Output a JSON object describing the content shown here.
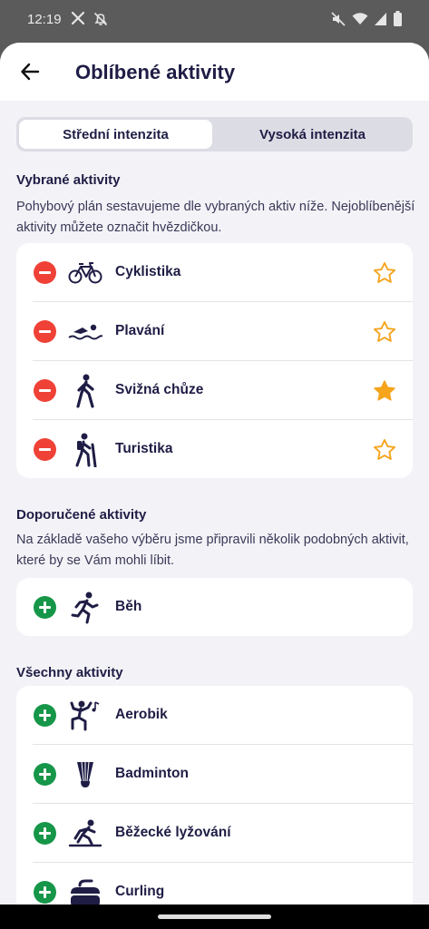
{
  "status_bar": {
    "time": "12:19",
    "left_icons": [
      "x-logo-icon",
      "notifications-off-icon"
    ],
    "right_icons": [
      "do-not-disturb-icon",
      "wifi-icon",
      "cellular-icon",
      "battery-icon"
    ]
  },
  "header": {
    "title": "Oblíbené aktivity",
    "back_icon": "arrow-left-icon"
  },
  "intensity_tabs": [
    {
      "label": "Střední intenzita",
      "selected": true
    },
    {
      "label": "Vysoká intenzita",
      "selected": false
    }
  ],
  "selected_section": {
    "title": "Vybrané aktivity",
    "description": "Pohybový plán sestavujeme dle vybraných aktiv níže. Nejoblíbenější aktivity můžete označit hvězdičkou.",
    "items": [
      {
        "label": "Cyklistika",
        "icon": "bicycle-icon",
        "favorite": false
      },
      {
        "label": "Plavání",
        "icon": "swimming-icon",
        "favorite": false
      },
      {
        "label": "Svižná chůze",
        "icon": "walking-icon",
        "favorite": true
      },
      {
        "label": "Turistika",
        "icon": "hiking-icon",
        "favorite": false
      }
    ]
  },
  "recommended_section": {
    "title": "Doporučené aktivity",
    "description": "Na základě vašeho výběru jsme připravili několik podobných aktivit, které by se Vám mohli líbit.",
    "items": [
      {
        "label": "Běh",
        "icon": "running-icon"
      }
    ]
  },
  "all_section": {
    "title": "Všechny aktivity",
    "items": [
      {
        "label": "Aerobik",
        "icon": "aerobics-icon"
      },
      {
        "label": "Badminton",
        "icon": "shuttlecock-icon"
      },
      {
        "label": "Běžecké lyžování",
        "icon": "cross-country-skiing-icon"
      },
      {
        "label": "Curling",
        "icon": "curling-stone-icon"
      }
    ]
  },
  "colors": {
    "remove": "#ef4136",
    "add": "#169648",
    "star": "#f5a41c",
    "text": "#1f1d45",
    "background": "#f3f3f7"
  }
}
